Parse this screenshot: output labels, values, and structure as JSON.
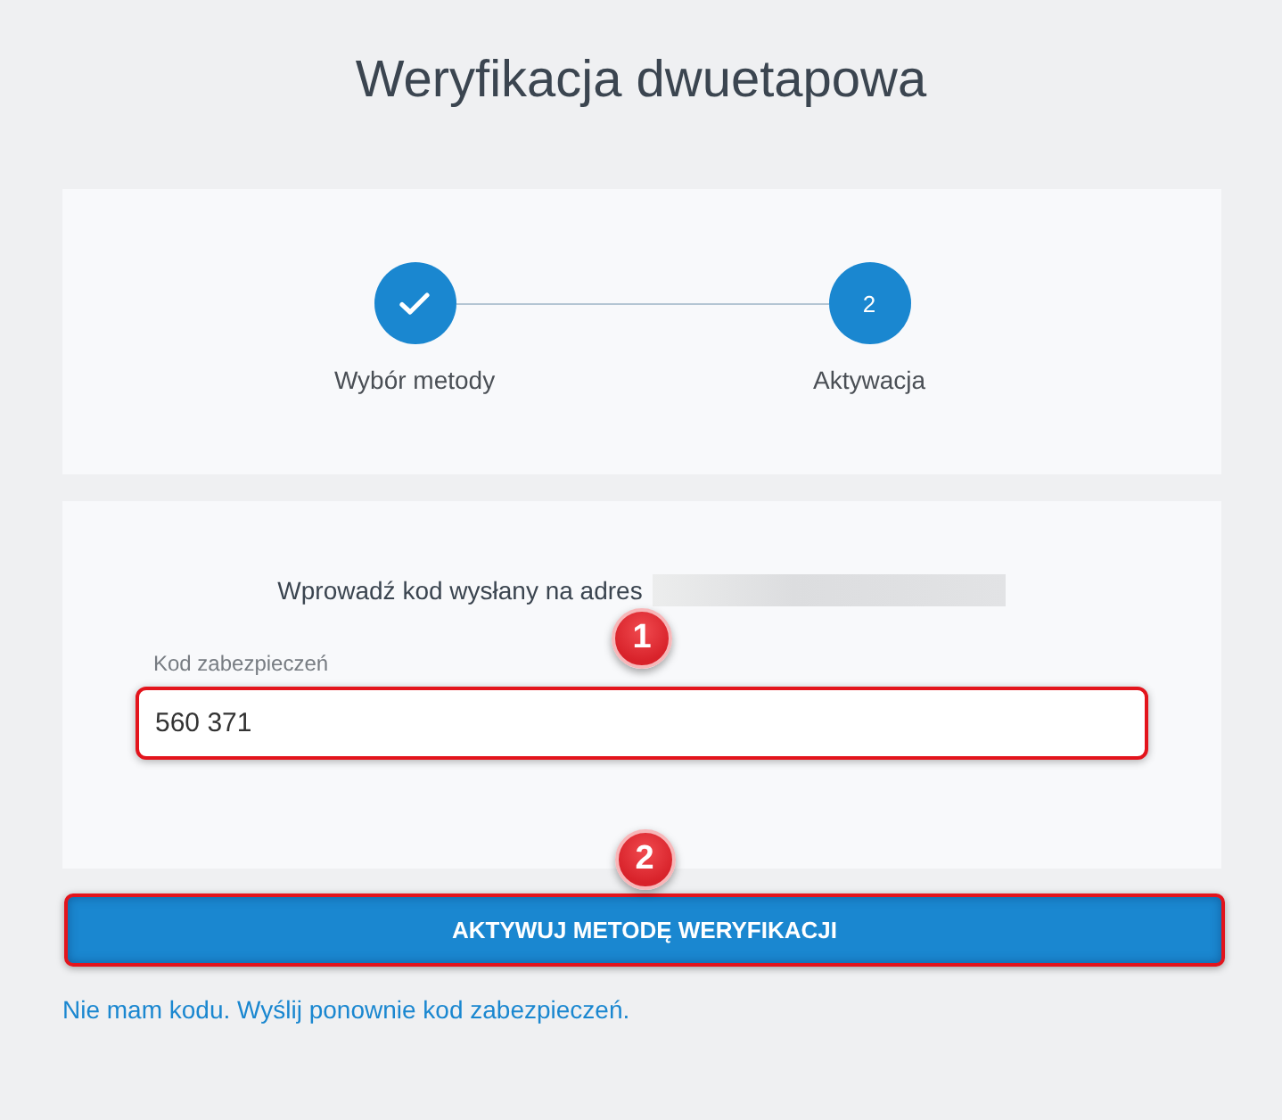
{
  "title": "Weryfikacja dwuetapowa",
  "steps": [
    {
      "label": "Wybór metody",
      "completed": true
    },
    {
      "label": "Aktywacja",
      "number": "2",
      "completed": false
    }
  ],
  "form": {
    "instruction": "Wprowadź kod wysłany na adres",
    "address_redacted": true,
    "code_field": {
      "label": "Kod zabezpieczeń",
      "value": "560 371",
      "highlighted": true,
      "annotation": "1"
    }
  },
  "submit_button": {
    "label": "AKTYWUJ METODĘ WERYFIKACJI",
    "highlighted": true,
    "annotation": "2"
  },
  "resend_link": "Nie mam kodu. Wyślij ponownie kod zabezpieczeń."
}
